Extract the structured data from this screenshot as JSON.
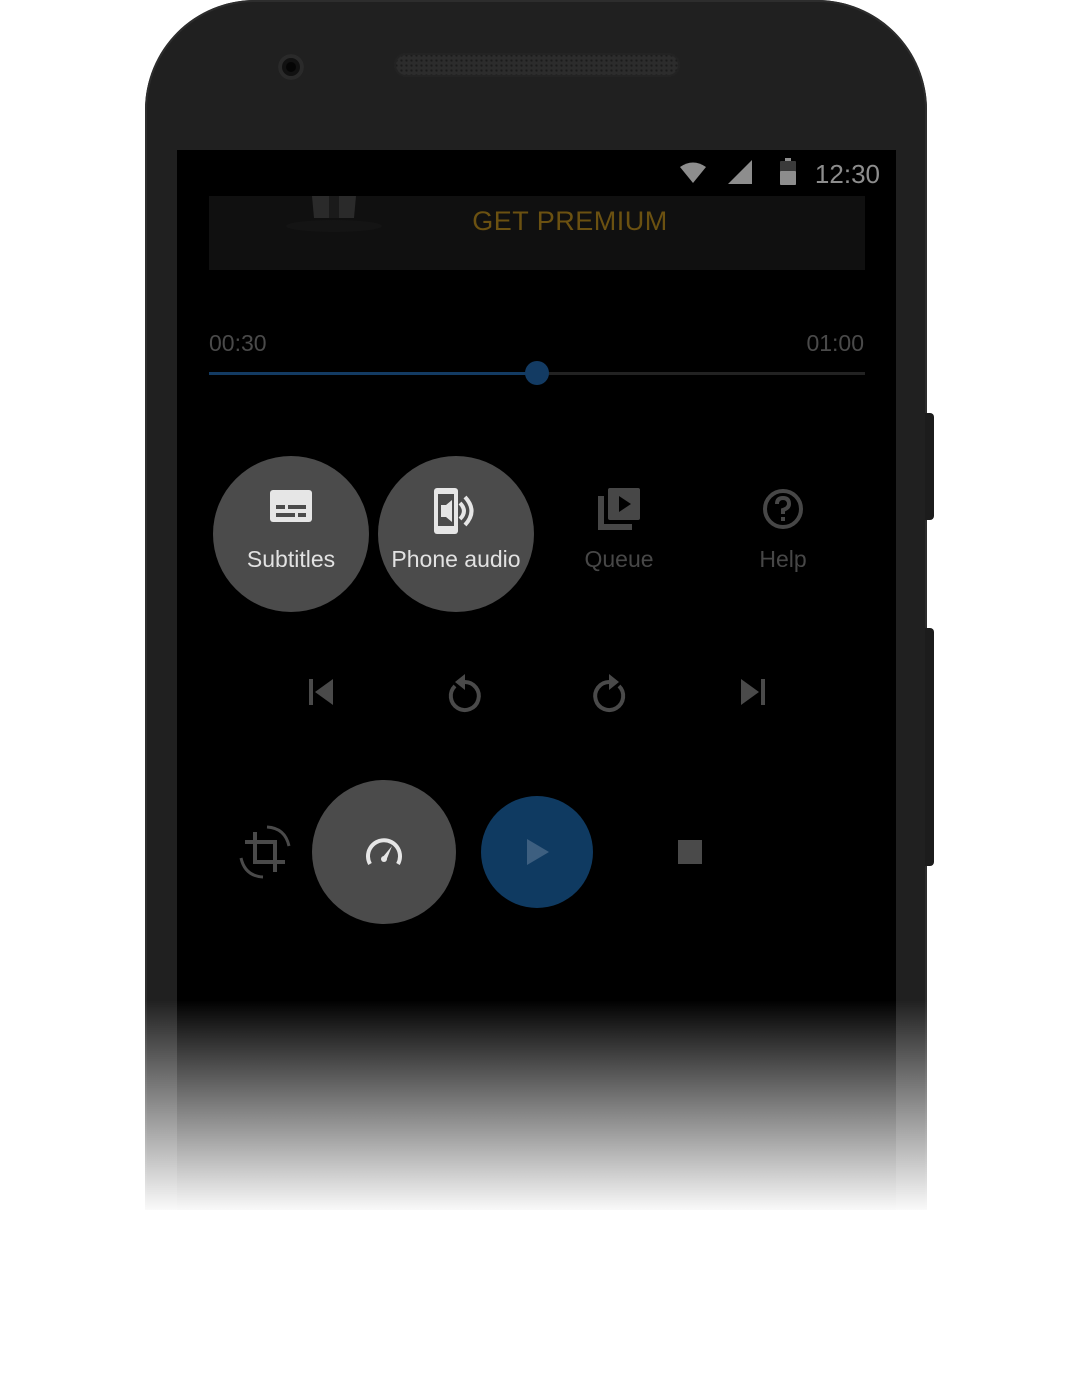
{
  "status_bar": {
    "time": "12:30",
    "icons": [
      "wifi-icon",
      "signal-icon",
      "battery-icon"
    ]
  },
  "banner": {
    "label": "GET PREMIUM",
    "accent_color": "#6b5111"
  },
  "playback": {
    "elapsed": "00:30",
    "duration": "01:00",
    "progress": 0.5,
    "accent_color": "#133b63"
  },
  "actions": [
    {
      "label": "Subtitles",
      "icon": "subtitles-icon",
      "active": true
    },
    {
      "label": "Phone audio",
      "icon": "phone-audio-icon",
      "active": true
    },
    {
      "label": "Queue",
      "icon": "queue-icon",
      "active": false
    },
    {
      "label": "Help",
      "icon": "help-icon",
      "active": false
    }
  ],
  "transport": {
    "icons": [
      "skip-previous-icon",
      "rewind-icon",
      "forward-icon",
      "skip-next-icon"
    ]
  },
  "bottom_controls": {
    "icons": [
      "crop-rotate-icon",
      "speed-icon",
      "play-icon",
      "stop-icon"
    ]
  }
}
